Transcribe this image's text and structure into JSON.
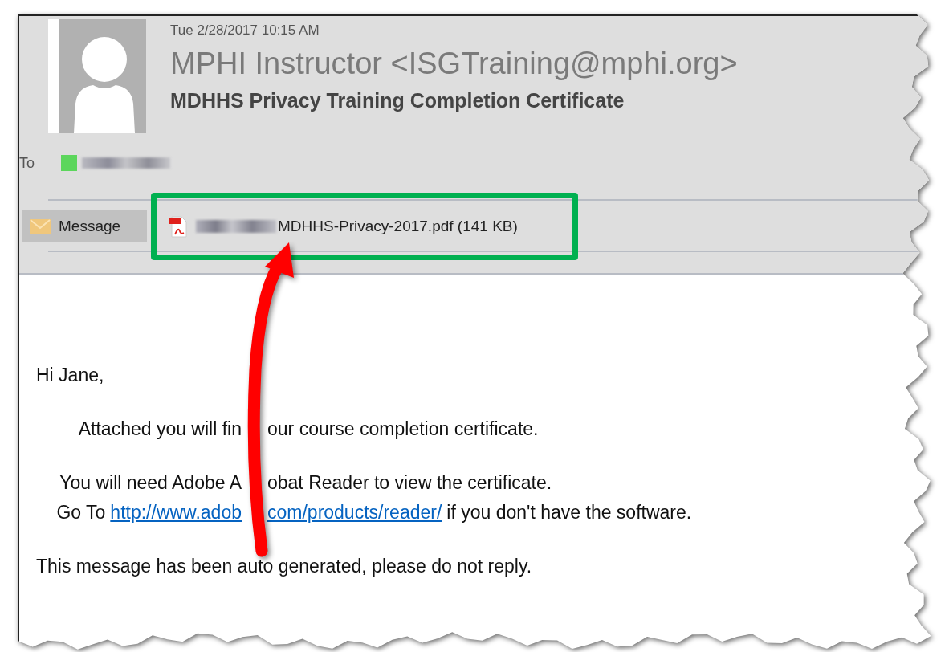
{
  "email": {
    "date": "Tue 2/28/2017 10:15 AM",
    "sender": "MPHI Instructor <ISGTraining@mphi.org>",
    "subject": "MDHHS Privacy Training Completion Certificate",
    "to_label": "To"
  },
  "tabs": [
    {
      "kind": "message",
      "label": "Message",
      "selected": true
    },
    {
      "kind": "pdf",
      "label": "MDHHS-Privacy-2017.pdf (141 KB)",
      "selected": false
    }
  ],
  "body": {
    "paragraphs": [
      {
        "lines": [
          {
            "left": [
              {
                "kind": "text",
                "text": "Hi Jane,"
              }
            ]
          }
        ]
      },
      {
        "lines": [
          {
            "left": [
              {
                "kind": "text",
                "text": "Attached you will fin"
              }
            ],
            "right": [
              {
                "kind": "text",
                "text": "our course completion certificate."
              }
            ]
          }
        ]
      },
      {
        "lines": [
          {
            "left": [
              {
                "kind": "text",
                "text": "You will need Adobe A"
              }
            ],
            "right": [
              {
                "kind": "text",
                "text": "obat Reader to view the certificate."
              }
            ]
          },
          {
            "left": [
              {
                "kind": "text",
                "text": "Go To"
              },
              {
                "kind": "link",
                "text": "http://www.adob"
              }
            ],
            "right": [
              {
                "kind": "link",
                "text": "com/products/reader/"
              },
              {
                "kind": "text",
                "text": "if you don't have the software."
              }
            ]
          }
        ]
      },
      {
        "lines": [
          {
            "left": [
              {
                "kind": "text",
                "text": "This message has been auto generated, please do not reply."
              }
            ]
          }
        ]
      }
    ]
  }
}
